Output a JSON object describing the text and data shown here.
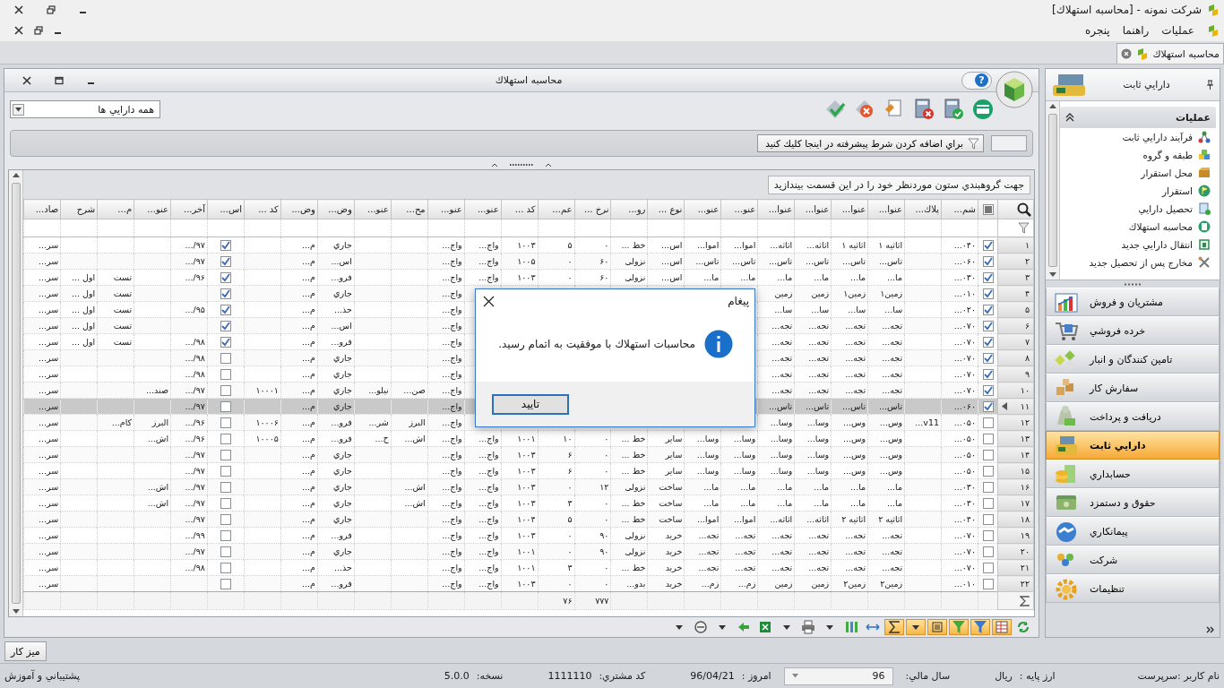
{
  "window": {
    "title": "شرکت نمونه - [محاسبه استهلاك]"
  },
  "menu": [
    "عمليات",
    "راهنما",
    "پنجره"
  ],
  "doc_tabs": [
    {
      "label": "محاسبه استهلاك",
      "selected": true
    }
  ],
  "child_window": {
    "title": "محاسبه استهلاك",
    "help": "?"
  },
  "asset_filter": {
    "value": "همه دارايي ها"
  },
  "filter_bar": {
    "button": "براي اضافه كردن شرط پيشرفته در اينجا كليك كنيد"
  },
  "group_panel": "جهت گروهبندي ستون موردنظر خود را در اين قسمت بيندازيد",
  "table": {
    "columns": [
      {
        "label": "شم...",
        "kind": "text"
      },
      {
        "label": "پلاك...",
        "kind": "text"
      },
      {
        "label": "عنوا...",
        "kind": "text"
      },
      {
        "label": "عنوا...",
        "kind": "text"
      },
      {
        "label": "عنوا...",
        "kind": "text"
      },
      {
        "label": "عنوا...",
        "kind": "text"
      },
      {
        "label": "عنو...",
        "kind": "text"
      },
      {
        "label": "عنو...",
        "kind": "text"
      },
      {
        "label": "نوع ...",
        "kind": "text"
      },
      {
        "label": "رو...",
        "kind": "text"
      },
      {
        "label": "نرخ ...",
        "kind": "text",
        "total": "۷۷۷"
      },
      {
        "label": "عم...",
        "kind": "text",
        "total": "۷۶"
      },
      {
        "label": "كد ...",
        "kind": "text"
      },
      {
        "label": "عنو...",
        "kind": "text"
      },
      {
        "label": "عنو...",
        "kind": "text"
      },
      {
        "label": "مح...",
        "kind": "text"
      },
      {
        "label": "عنو...",
        "kind": "text"
      },
      {
        "label": "وض...",
        "kind": "text"
      },
      {
        "label": "وض...",
        "kind": "text"
      },
      {
        "label": "كد ...",
        "kind": "text"
      },
      {
        "label": "اس...",
        "kind": "check"
      },
      {
        "label": "آخر...",
        "kind": "text"
      },
      {
        "label": "عنو...",
        "kind": "text"
      },
      {
        "label": "م...",
        "kind": "text"
      },
      {
        "label": "شرح",
        "kind": "text"
      },
      {
        "label": "صاد...",
        "kind": "text"
      }
    ],
    "rows": [
      {
        "number": "۱",
        "checked": true,
        "selected": false,
        "cells": [
          "۰۴۰...",
          null,
          "اثاثیه ۱",
          "اثاثیه ۱",
          "اثاثه...",
          "اثاثه...",
          "اموا...",
          "اموا...",
          "اس...",
          "خط ...",
          "۰",
          "۵",
          "۱۰۰۳",
          "واج...",
          "واج...",
          null,
          null,
          "جاري",
          "م...",
          null,
          true,
          "۹۷/...",
          null,
          null,
          null,
          "سر..."
        ]
      },
      {
        "number": "۲",
        "checked": true,
        "selected": false,
        "cells": [
          "۰۶۰...",
          null,
          "تاس...",
          "تاس...",
          "تاس...",
          "تاس...",
          "تاس...",
          "تاس...",
          "اس...",
          "نزولی",
          "۶۰",
          "۰",
          "۱۰۰۵",
          "واج...",
          "واج...",
          null,
          null,
          "اس...",
          "م...",
          null,
          true,
          "۹۷/...",
          null,
          null,
          null,
          "سر..."
        ]
      },
      {
        "number": "۳",
        "checked": true,
        "selected": false,
        "cells": [
          "۰۳۰...",
          null,
          "ما...",
          "ما...",
          "ما...",
          "ما...",
          "ما...",
          "ما...",
          "اس...",
          "نزولی",
          "۶۰",
          "۰",
          "۱۰۰۳",
          "واج...",
          "واج...",
          null,
          null,
          "فرو...",
          "م...",
          null,
          true,
          "۹۶/...",
          null,
          "تست",
          "اول ...",
          "سر..."
        ]
      },
      {
        "number": "۴",
        "checked": true,
        "selected": false,
        "cells": [
          "۰۱۰...",
          null,
          "زمین۱",
          "زمین۱",
          "زمین",
          "زمین",
          null,
          null,
          null,
          null,
          null,
          null,
          null,
          null,
          "واج...",
          null,
          null,
          "جاري",
          "م...",
          null,
          true,
          null,
          null,
          "تست",
          "اول ...",
          "سر..."
        ]
      },
      {
        "number": "۵",
        "checked": true,
        "selected": false,
        "cells": [
          "۰۲۰...",
          null,
          "سا...",
          "سا...",
          "سا...",
          "سا...",
          null,
          null,
          null,
          null,
          null,
          null,
          null,
          null,
          "واج...",
          null,
          null,
          "حذ...",
          "م...",
          null,
          true,
          "۹۵/...",
          null,
          "تست",
          "اول ...",
          "سر..."
        ]
      },
      {
        "number": "۶",
        "checked": true,
        "selected": false,
        "cells": [
          "۰۷۰...",
          null,
          "تجه...",
          "تجه...",
          "تجه...",
          "تجه...",
          null,
          null,
          null,
          null,
          null,
          null,
          null,
          null,
          "واج...",
          null,
          null,
          "اس...",
          "م...",
          null,
          true,
          null,
          null,
          "تست",
          "اول ...",
          "سر..."
        ]
      },
      {
        "number": "۷",
        "checked": true,
        "selected": false,
        "cells": [
          "۰۷۰...",
          null,
          "تجه...",
          "تجه...",
          "تجه...",
          "تجه...",
          null,
          null,
          null,
          null,
          null,
          null,
          null,
          null,
          "واج...",
          null,
          null,
          "فرو...",
          "م...",
          null,
          true,
          "۹۸/...",
          null,
          "تست",
          "اول ...",
          "سر..."
        ]
      },
      {
        "number": "۸",
        "checked": true,
        "selected": false,
        "cells": [
          "۰۷۰...",
          null,
          "تجه...",
          "تجه...",
          "تجه...",
          "تجه...",
          null,
          null,
          null,
          null,
          null,
          null,
          null,
          null,
          "واج...",
          null,
          null,
          "جاري",
          "م...",
          null,
          false,
          "۹۸/...",
          null,
          null,
          null,
          "سر..."
        ]
      },
      {
        "number": "۹",
        "checked": true,
        "selected": false,
        "cells": [
          "۰۷۰...",
          null,
          "تجه...",
          "تجه...",
          "تجه...",
          "تجه...",
          null,
          null,
          null,
          null,
          null,
          null,
          null,
          null,
          "واج...",
          null,
          null,
          "جاري",
          "م...",
          null,
          false,
          "۹۸/...",
          null,
          null,
          null,
          "سر..."
        ]
      },
      {
        "number": "۱۰",
        "checked": true,
        "selected": false,
        "cells": [
          "۰۷۰...",
          null,
          "تجه...",
          "تجه...",
          "تجه...",
          "تجه...",
          null,
          null,
          null,
          null,
          null,
          null,
          null,
          null,
          "واج...",
          "صن...",
          "نیلو...",
          "جاري",
          "م...",
          "۱۰۰۰۱",
          false,
          "۹۷/...",
          "صند...",
          null,
          null,
          "سر..."
        ]
      },
      {
        "number": "۱۱",
        "checked": true,
        "selected": true,
        "cells": [
          "۰۶۰...",
          null,
          "تاس...",
          "تاس...",
          "تاس...",
          "تاس...",
          null,
          null,
          null,
          null,
          null,
          null,
          null,
          null,
          "واج...",
          null,
          null,
          "جاري",
          "م...",
          null,
          false,
          "۹۷/...",
          null,
          null,
          null,
          "سر..."
        ]
      },
      {
        "number": "۱۲",
        "checked": false,
        "selected": false,
        "cells": [
          "۰۵۰...",
          "v11...",
          "وس...",
          "وس...",
          "وسا...",
          "وسا...",
          null,
          null,
          null,
          null,
          null,
          null,
          null,
          null,
          "واج...",
          "البرز",
          "شر...",
          "فرو...",
          "م...",
          "۱۰۰۰۶",
          false,
          "۹۶/...",
          "البرز",
          "کام...",
          null,
          "سر..."
        ]
      },
      {
        "number": "۱۳",
        "checked": false,
        "selected": false,
        "cells": [
          "۰۵۰...",
          null,
          "وس...",
          "وس...",
          "وسا...",
          "وسا...",
          "وسا...",
          "وسا...",
          "سایر",
          "خط ...",
          "۰",
          "۱۰",
          "۱۰۰۱",
          "واج...",
          "واج...",
          "اش...",
          "ح...",
          "فرو...",
          "م...",
          "۱۰۰۰۵",
          false,
          "۹۶/...",
          "اش...",
          null,
          null,
          "سر..."
        ]
      },
      {
        "number": "۱۴",
        "checked": false,
        "selected": false,
        "cells": [
          "۰۵۰...",
          null,
          "وس...",
          "وس...",
          "وسا...",
          "وسا...",
          "وسا...",
          "وسا...",
          "سایر",
          "خط ...",
          "۰",
          "۶",
          "۱۰۰۳",
          "واج...",
          "واج...",
          null,
          null,
          "جاري",
          "م...",
          null,
          false,
          "۹۷/...",
          null,
          null,
          null,
          "سر..."
        ]
      },
      {
        "number": "۱۵",
        "checked": false,
        "selected": false,
        "cells": [
          "۰۵۰...",
          null,
          "وس...",
          "وس...",
          "وسا...",
          "وسا...",
          "وسا...",
          "وسا...",
          "سایر",
          "خط ...",
          "۰",
          "۶",
          "۱۰۰۳",
          "واج...",
          "واج...",
          null,
          null,
          "جاري",
          "م...",
          null,
          false,
          "۹۷/...",
          null,
          null,
          null,
          "سر..."
        ]
      },
      {
        "number": "۱۶",
        "checked": false,
        "selected": false,
        "cells": [
          "۰۳۰...",
          null,
          "ما...",
          "ما...",
          "ما...",
          "ما...",
          "ما...",
          "ما...",
          "ساخت",
          "نزولی",
          "۱۲",
          "۰",
          "۱۰۰۳",
          "واج...",
          "واج...",
          "اش...",
          null,
          "جاري",
          "م...",
          null,
          false,
          "۹۷/...",
          "اش...",
          null,
          null,
          "سر..."
        ]
      },
      {
        "number": "۱۷",
        "checked": false,
        "selected": false,
        "cells": [
          "۰۳۰...",
          null,
          "ما...",
          "ما...",
          "ما...",
          "ما...",
          "ما...",
          "ما...",
          "ساخت",
          "خط ...",
          "۰",
          "۳",
          "۱۰۰۳",
          "واج...",
          "واج...",
          "اش...",
          null,
          "جاري",
          "م...",
          null,
          false,
          "۹۷/...",
          "اش...",
          null,
          null,
          "سر..."
        ]
      },
      {
        "number": "۱۸",
        "checked": false,
        "selected": false,
        "cells": [
          "۰۴۰...",
          null,
          "اثاثیه ۲",
          "اثاثیه ۲",
          "اثاثه...",
          "اثاثه...",
          "اموا...",
          "اموا...",
          "ساخت",
          "خط ...",
          "۰",
          "۵",
          "۱۰۰۴",
          "واج...",
          "واج...",
          null,
          null,
          "جاري",
          "م...",
          null,
          false,
          "۹۷/...",
          null,
          null,
          null,
          "سر..."
        ]
      },
      {
        "number": "۱۹",
        "checked": false,
        "selected": false,
        "cells": [
          "۰۷۰...",
          null,
          "تجه...",
          "تجه...",
          "تجه...",
          "تجه...",
          "تجه...",
          "تجه...",
          "خرید",
          "نزولی",
          "۹۰",
          "۰",
          "۱۰۰۳",
          "واج...",
          "واج...",
          null,
          null,
          "فرو...",
          "م...",
          null,
          false,
          "۹۹/...",
          null,
          null,
          null,
          "سر..."
        ]
      },
      {
        "number": "۲۰",
        "checked": false,
        "selected": false,
        "cells": [
          "۰۷۰...",
          null,
          "تجه...",
          "تجه...",
          "تجه...",
          "تجه...",
          "تجه...",
          "تجه...",
          "خرید",
          "نزولی",
          "۹۰",
          "۰",
          "۱۰۰۱",
          "واج...",
          "واج...",
          null,
          null,
          "جاري",
          "م...",
          null,
          false,
          "۹۷/...",
          null,
          null,
          null,
          "سر..."
        ]
      },
      {
        "number": "۲۱",
        "checked": false,
        "selected": false,
        "cells": [
          "۰۷۰...",
          null,
          "تجه...",
          "تجه...",
          "تجه...",
          "تجه...",
          "تجه...",
          "تجه...",
          "خرید",
          "خط ...",
          "۰",
          "۳",
          "۱۰۰۱",
          "واج...",
          "واج...",
          null,
          null,
          "حذ...",
          "م...",
          null,
          false,
          "۹۸/...",
          null,
          null,
          null,
          "سر..."
        ]
      },
      {
        "number": "۲۲",
        "checked": false,
        "selected": false,
        "cells": [
          "۰۱۰...",
          null,
          "زمین۲",
          "زمین۲",
          "زمین",
          "زمین",
          "زم...",
          "زم...",
          "خرید",
          "بدو...",
          "۰",
          "۰",
          "۱۰۰۳",
          "واج...",
          "واج...",
          null,
          null,
          "فرو...",
          "م...",
          null,
          false,
          null,
          null,
          null,
          null,
          "سر..."
        ]
      }
    ],
    "select_all_partial": true
  },
  "grid_toolbar": [
    {
      "on": false
    },
    {
      "on": true
    },
    {
      "on": true
    },
    {
      "on": true
    },
    {
      "on": true
    },
    {
      "on": true
    },
    {
      "on": true
    },
    {
      "on": false
    },
    {
      "on": false
    },
    {
      "on": false
    },
    {
      "on": false
    },
    {
      "on": false
    },
    {
      "on": false
    },
    {
      "on": false
    },
    {
      "on": false
    },
    {
      "on": false
    },
    {
      "on": false
    }
  ],
  "sidebar": {
    "title": "دارايي ثابت",
    "section": {
      "title": "عمليات",
      "expanded": true,
      "items": [
        "فرآيند دارايي ثابت",
        "طبقه و گروه",
        "محل استقرار",
        "استقرار",
        "تحصيل دارايي",
        "محاسبه استهلاك",
        "انتقال دارايي جديد",
        "مخارج پس از تحصيل جديد"
      ]
    },
    "modules": [
      {
        "label": "مشتريان و فروش",
        "selected": false
      },
      {
        "label": "خرده فروشي",
        "selected": false
      },
      {
        "label": "تامين كنندگان و انبار",
        "selected": false
      },
      {
        "label": "سفارش كار",
        "selected": false
      },
      {
        "label": "دريافت و پرداخت",
        "selected": false
      },
      {
        "label": "دارايي ثابت",
        "selected": true
      },
      {
        "label": "حسابداري",
        "selected": false
      },
      {
        "label": "حقوق و دستمزد",
        "selected": false
      },
      {
        "label": "پيمانكاري",
        "selected": false
      },
      {
        "label": "شركت",
        "selected": false
      },
      {
        "label": "تنظيمات",
        "selected": false
      }
    ]
  },
  "taskbar": [
    "ميز كار"
  ],
  "status_bar": {
    "user": "نام كاربر :سرپرست",
    "currency_label": "ارز پايه :",
    "currency": "ريال",
    "fiscal_year_label": "سال مالي:",
    "fiscal_year": "96",
    "today_label": "امروز :",
    "today": "96/04/21",
    "customer_code_label": "كد مشتري:",
    "customer_code": "1111110",
    "version_label": "نسخه:",
    "version": "5.0.0",
    "support": "پشتيباني و آموزش"
  },
  "dialog": {
    "title": "پيغام",
    "message": "محاسبات استهلاك با موفقيت به اتمام رسيد.",
    "button": "تاييد"
  }
}
